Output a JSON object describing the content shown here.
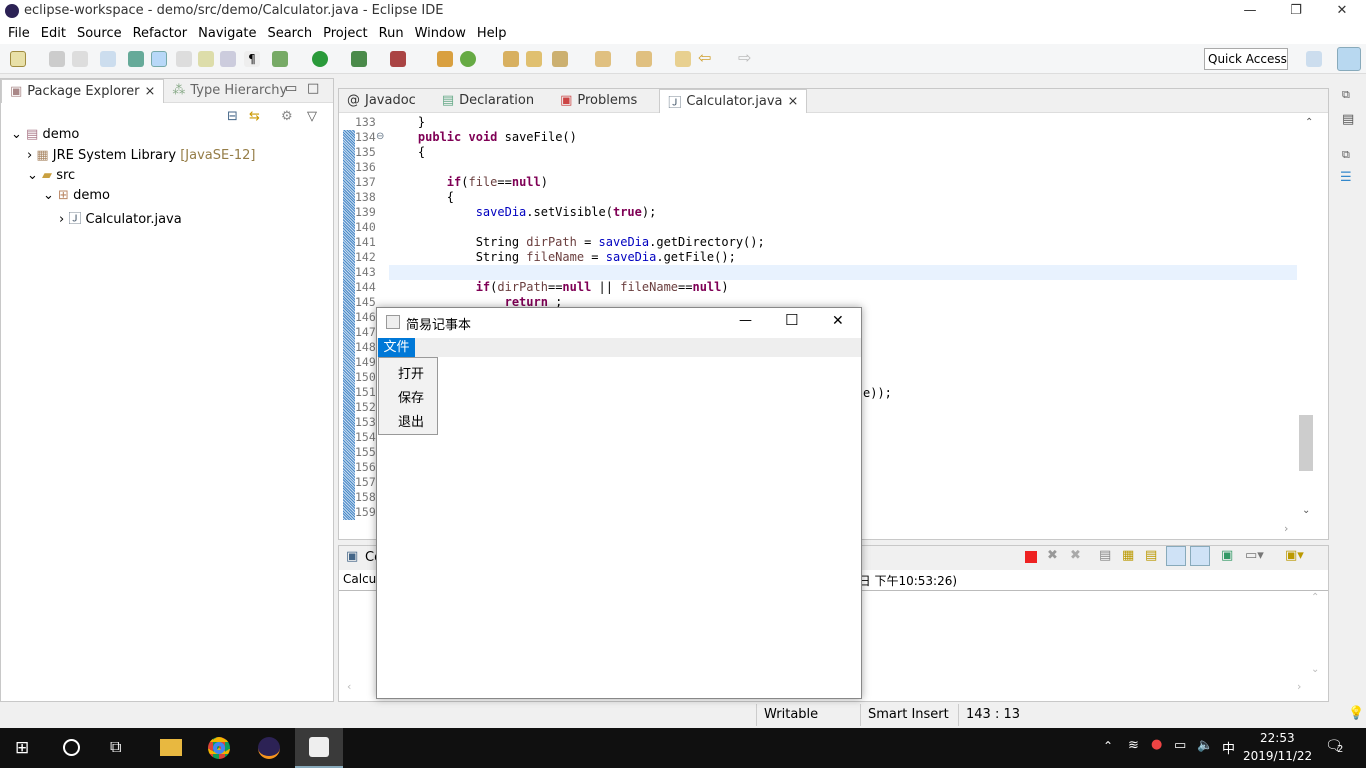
{
  "window": {
    "title": "eclipse-workspace - demo/src/demo/Calculator.java - Eclipse IDE",
    "minimize": "—",
    "maximize": "❐",
    "close": "✕"
  },
  "menu": [
    "File",
    "Edit",
    "Source",
    "Refactor",
    "Navigate",
    "Search",
    "Project",
    "Run",
    "Window",
    "Help"
  ],
  "quick_access": "Quick Access",
  "package_explorer": {
    "tabs": [
      {
        "label": "Package Explorer",
        "close": "⨯"
      },
      {
        "label": "Type Hierarchy"
      }
    ],
    "tree": [
      {
        "label": "demo",
        "extra": ""
      },
      {
        "label": "JRE System Library",
        "extra": "[JavaSE-12]"
      },
      {
        "label": "src",
        "extra": ""
      },
      {
        "label": "demo",
        "extra": ""
      },
      {
        "label": "Calculator.java",
        "extra": ""
      }
    ]
  },
  "editor": {
    "tabs": [
      {
        "label": "Javadoc"
      },
      {
        "label": "Declaration"
      },
      {
        "label": "Problems"
      },
      {
        "label": "Calculator.java",
        "close": "⨯"
      }
    ],
    "line_numbers": [
      "133",
      "134",
      "135",
      "136",
      "137",
      "138",
      "139",
      "140",
      "141",
      "142",
      "143",
      "144",
      "145",
      "146",
      "147",
      "148",
      "149",
      "150",
      "151",
      "152",
      "153",
      "154",
      "155",
      "156",
      "157",
      "158",
      "159"
    ],
    "lines": [
      "    }",
      "    public void saveFile()",
      "    {",
      "",
      "        if(file==null)",
      "        {",
      "            saveDia.setVisible(true);",
      "",
      "            String dirPath = saveDia.getDirectory();",
      "            String fileName = saveDia.getFile();",
      "",
      "            if(dirPath==null || fileName==null)",
      "                return ;"
    ],
    "partial_line_151": "e));",
    "current_line": "143"
  },
  "console": {
    "tab": "Co",
    "title_prefix": "Calcul",
    "title_suffix": "2日 下午10:53:26)"
  },
  "status": {
    "writable": "Writable",
    "insert_mode": "Smart Insert",
    "position": "143 : 13"
  },
  "dialog": {
    "title": "简易记事本",
    "menu_file": "文件",
    "items": [
      "打开",
      "保存",
      "退出"
    ],
    "minimize": "—",
    "maximize": "☐",
    "close": "✕"
  },
  "taskbar": {
    "time": "22:53",
    "date": "2019/11/22",
    "ime": "中",
    "notifications": "2"
  },
  "colors": {
    "accent": "#0078d7",
    "keyword": "#7f0055",
    "field": "#0000c0",
    "current_line": "#e8f2fe"
  }
}
